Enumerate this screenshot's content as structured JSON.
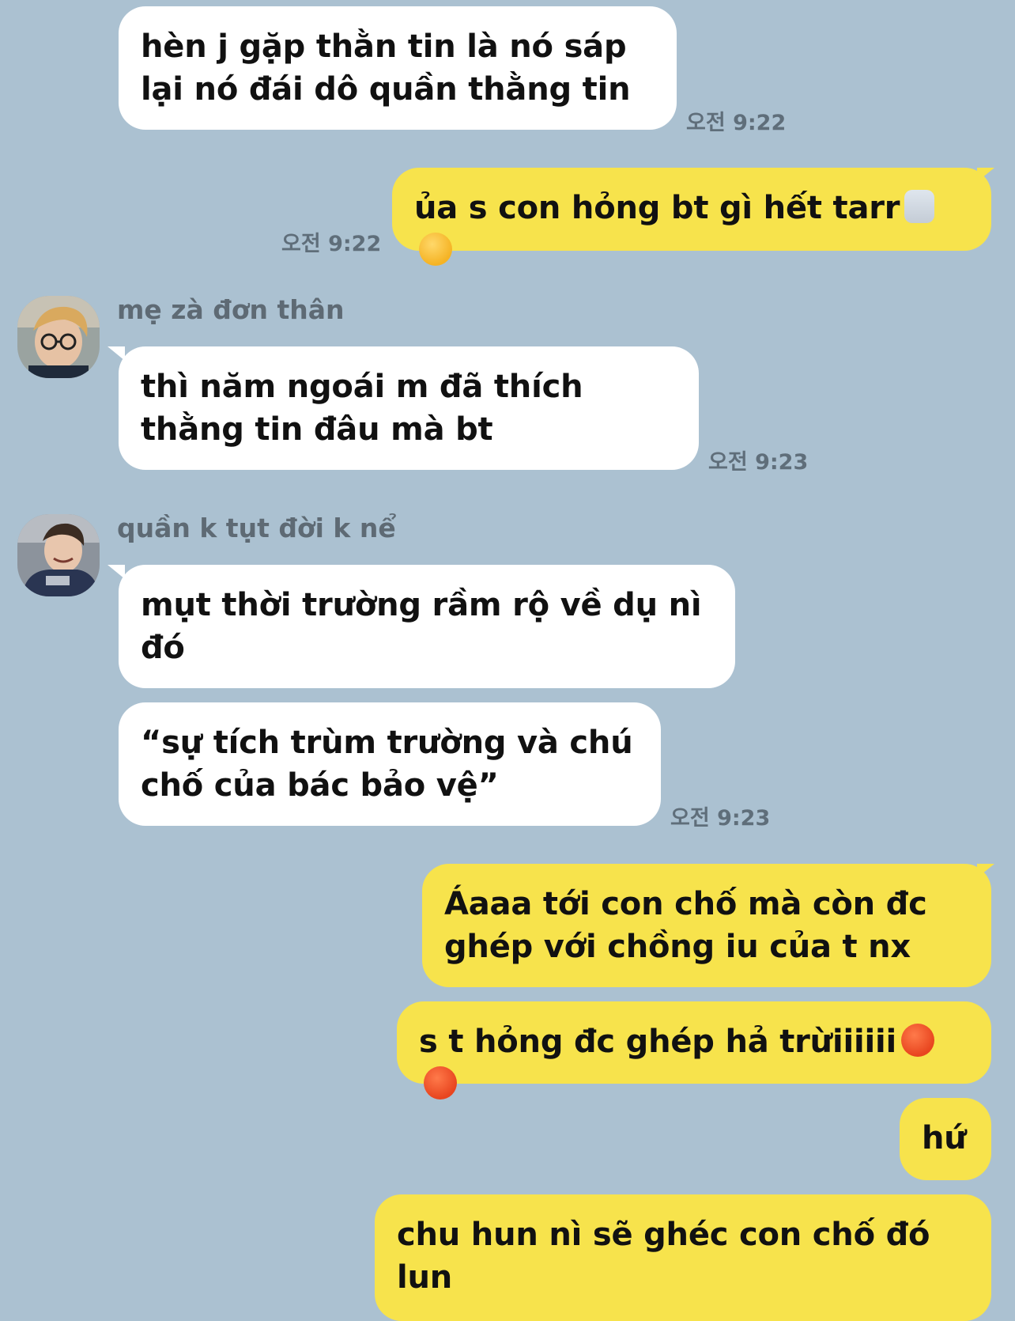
{
  "messages": {
    "m1": {
      "text": "hèn j gặp thằn tin là nó sáp lại nó đái dô quần thằng tin",
      "time": "오전 9:22"
    },
    "m2": {
      "text": "ủa s con hỏng bt gì hết tarr",
      "emoji1": "person-shrugging-icon",
      "emoji2": "face-with-steam-icon",
      "time": "오전 9:22"
    },
    "m3": {
      "sender": "mẹ zà đơn thân",
      "text": "thì năm ngoái m đã thích thằng tin đâu mà bt",
      "time": "오전 9:23"
    },
    "m4": {
      "sender": "quần k tụt đời k nể",
      "text": "mụt thời trường rầm rộ về dụ nì đó"
    },
    "m5": {
      "text": "“sự tích trùm trường và chú chố của bác bảo vệ”",
      "time": "오전 9:23"
    },
    "m6": {
      "text": "Áaaa tới con chố mà còn đc ghép với chồng iu của t nx"
    },
    "m7": {
      "text": "s t hỏng đc ghép hả trừiiiiii",
      "emoji1": "angry-face-icon",
      "emoji2": "angry-face-icon"
    },
    "m8": {
      "text": "hứ"
    },
    "m9": {
      "text": "chu hun nì sẽ ghéc con chố đó lun"
    }
  },
  "colors": {
    "background": "#abc1d1",
    "incoming_bubble": "#ffffff",
    "outgoing_bubble": "#f7e34c",
    "time_text": "#5f6e7a"
  }
}
